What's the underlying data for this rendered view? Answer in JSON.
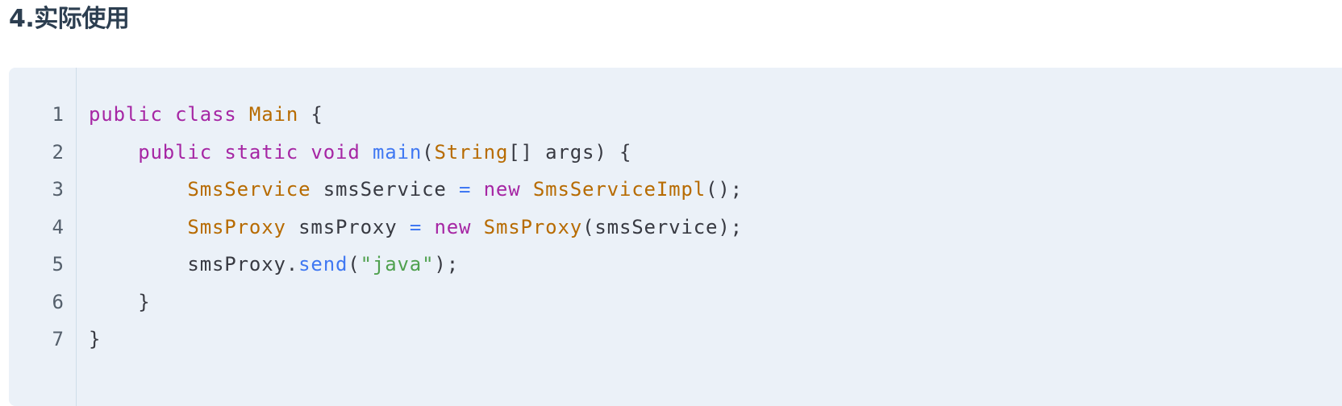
{
  "heading": "4.实际使用",
  "code": {
    "language": "java",
    "line_numbers": [
      "1",
      "2",
      "3",
      "4",
      "5",
      "6",
      "7"
    ],
    "lines": [
      [
        {
          "t": "keyword",
          "v": "public"
        },
        {
          "t": "plain",
          "v": " "
        },
        {
          "t": "keyword",
          "v": "class"
        },
        {
          "t": "plain",
          "v": " "
        },
        {
          "t": "type",
          "v": "Main"
        },
        {
          "t": "plain",
          "v": " {"
        }
      ],
      [
        {
          "t": "plain",
          "v": "    "
        },
        {
          "t": "keyword",
          "v": "public"
        },
        {
          "t": "plain",
          "v": " "
        },
        {
          "t": "keyword",
          "v": "static"
        },
        {
          "t": "plain",
          "v": " "
        },
        {
          "t": "keyword",
          "v": "void"
        },
        {
          "t": "plain",
          "v": " "
        },
        {
          "t": "function",
          "v": "main"
        },
        {
          "t": "punct",
          "v": "("
        },
        {
          "t": "type",
          "v": "String"
        },
        {
          "t": "punct",
          "v": "[] args) {"
        }
      ],
      [
        {
          "t": "plain",
          "v": "        "
        },
        {
          "t": "type",
          "v": "SmsService"
        },
        {
          "t": "plain",
          "v": " smsService "
        },
        {
          "t": "operator",
          "v": "="
        },
        {
          "t": "plain",
          "v": " "
        },
        {
          "t": "keyword",
          "v": "new"
        },
        {
          "t": "plain",
          "v": " "
        },
        {
          "t": "type",
          "v": "SmsServiceImpl"
        },
        {
          "t": "punct",
          "v": "();"
        }
      ],
      [
        {
          "t": "plain",
          "v": "        "
        },
        {
          "t": "type",
          "v": "SmsProxy"
        },
        {
          "t": "plain",
          "v": " smsProxy "
        },
        {
          "t": "operator",
          "v": "="
        },
        {
          "t": "plain",
          "v": " "
        },
        {
          "t": "keyword",
          "v": "new"
        },
        {
          "t": "plain",
          "v": " "
        },
        {
          "t": "type",
          "v": "SmsProxy"
        },
        {
          "t": "punct",
          "v": "(smsService);"
        }
      ],
      [
        {
          "t": "plain",
          "v": "        smsProxy."
        },
        {
          "t": "function",
          "v": "send"
        },
        {
          "t": "punct",
          "v": "("
        },
        {
          "t": "string",
          "v": "\"java\""
        },
        {
          "t": "punct",
          "v": ");"
        }
      ],
      [
        {
          "t": "plain",
          "v": "    }"
        }
      ],
      [
        {
          "t": "plain",
          "v": "}"
        }
      ]
    ]
  },
  "colors": {
    "code_background": "#ebf1f8",
    "keyword": "#a626a4",
    "type": "#b76b01",
    "function": "#4078f2",
    "string": "#50a14f",
    "plain": "#383a42",
    "line_number": "#55606c"
  }
}
